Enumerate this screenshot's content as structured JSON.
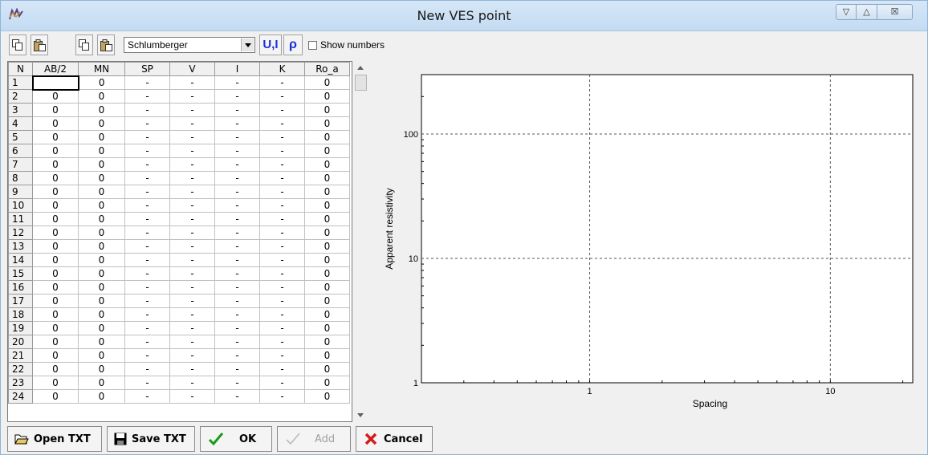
{
  "window": {
    "title": "New VES point",
    "minimize": "▽",
    "maximize": "△",
    "close": "☒"
  },
  "toolbar": {
    "array_type": "Schlumberger",
    "ui_label": "U,I",
    "rho_label": "ρ",
    "show_numbers_label": "Show numbers",
    "show_numbers_checked": false
  },
  "grid": {
    "columns": [
      "N",
      "AB/2",
      "MN",
      "SP",
      "V",
      "I",
      "K",
      "Ro_a"
    ],
    "rows": [
      [
        "1",
        "",
        "0",
        "-",
        "-",
        "-",
        "-",
        "0"
      ],
      [
        "2",
        "0",
        "0",
        "-",
        "-",
        "-",
        "-",
        "0"
      ],
      [
        "3",
        "0",
        "0",
        "-",
        "-",
        "-",
        "-",
        "0"
      ],
      [
        "4",
        "0",
        "0",
        "-",
        "-",
        "-",
        "-",
        "0"
      ],
      [
        "5",
        "0",
        "0",
        "-",
        "-",
        "-",
        "-",
        "0"
      ],
      [
        "6",
        "0",
        "0",
        "-",
        "-",
        "-",
        "-",
        "0"
      ],
      [
        "7",
        "0",
        "0",
        "-",
        "-",
        "-",
        "-",
        "0"
      ],
      [
        "8",
        "0",
        "0",
        "-",
        "-",
        "-",
        "-",
        "0"
      ],
      [
        "9",
        "0",
        "0",
        "-",
        "-",
        "-",
        "-",
        "0"
      ],
      [
        "10",
        "0",
        "0",
        "-",
        "-",
        "-",
        "-",
        "0"
      ],
      [
        "11",
        "0",
        "0",
        "-",
        "-",
        "-",
        "-",
        "0"
      ],
      [
        "12",
        "0",
        "0",
        "-",
        "-",
        "-",
        "-",
        "0"
      ],
      [
        "13",
        "0",
        "0",
        "-",
        "-",
        "-",
        "-",
        "0"
      ],
      [
        "14",
        "0",
        "0",
        "-",
        "-",
        "-",
        "-",
        "0"
      ],
      [
        "15",
        "0",
        "0",
        "-",
        "-",
        "-",
        "-",
        "0"
      ],
      [
        "16",
        "0",
        "0",
        "-",
        "-",
        "-",
        "-",
        "0"
      ],
      [
        "17",
        "0",
        "0",
        "-",
        "-",
        "-",
        "-",
        "0"
      ],
      [
        "18",
        "0",
        "0",
        "-",
        "-",
        "-",
        "-",
        "0"
      ],
      [
        "19",
        "0",
        "0",
        "-",
        "-",
        "-",
        "-",
        "0"
      ],
      [
        "20",
        "0",
        "0",
        "-",
        "-",
        "-",
        "-",
        "0"
      ],
      [
        "21",
        "0",
        "0",
        "-",
        "-",
        "-",
        "-",
        "0"
      ],
      [
        "22",
        "0",
        "0",
        "-",
        "-",
        "-",
        "-",
        "0"
      ],
      [
        "23",
        "0",
        "0",
        "-",
        "-",
        "-",
        "-",
        "0"
      ],
      [
        "24",
        "0",
        "0",
        "-",
        "-",
        "-",
        "-",
        "0"
      ]
    ]
  },
  "chart_data": {
    "type": "scatter",
    "xlabel": "Spacing",
    "ylabel": "Apparent resistivity",
    "xscale": "log",
    "yscale": "log",
    "xlim": [
      0.2,
      22
    ],
    "ylim": [
      1,
      300
    ],
    "x_ticks": [
      1,
      10
    ],
    "y_ticks": [
      1,
      10,
      100
    ],
    "grid": true,
    "series": []
  },
  "buttons": {
    "open": "Open TXT",
    "save": "Save TXT",
    "ok": "OK",
    "add": "Add",
    "cancel": "Cancel"
  }
}
